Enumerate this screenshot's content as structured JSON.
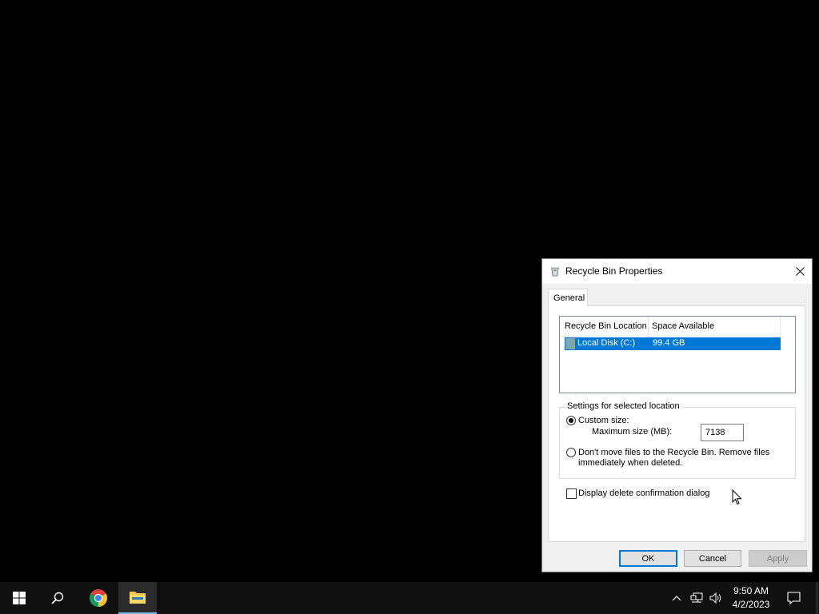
{
  "dialog": {
    "title": "Recycle Bin Properties",
    "tab": "General",
    "list_headers": [
      "Recycle Bin Location",
      "Space Available"
    ],
    "rows": [
      {
        "location": "Local Disk (C:)",
        "space": "99.4 GB",
        "selected": true
      }
    ],
    "settings_group_label": "Settings for selected location",
    "custom_size_label": "Custom size:",
    "custom_size_selected": true,
    "max_size_label": "Maximum size (MB):",
    "max_size_value": "7138",
    "dont_move_line1": "Don't move files to the Recycle Bin. Remove files",
    "dont_move_line2": "immediately when deleted.",
    "confirm_label": "Display delete confirmation dialog",
    "confirm_checked": false,
    "ok_label": "OK",
    "cancel_label": "Cancel",
    "apply_label": "Apply"
  },
  "taskbar": {
    "icons": [
      "start-icon",
      "search-icon",
      "chrome-icon",
      "file-explorer-icon"
    ],
    "time": "9:50 AM",
    "date": "4/2/2023"
  },
  "colors": {
    "selection": "#0078d7",
    "taskbar": "#101010",
    "desktop": "#000000"
  }
}
